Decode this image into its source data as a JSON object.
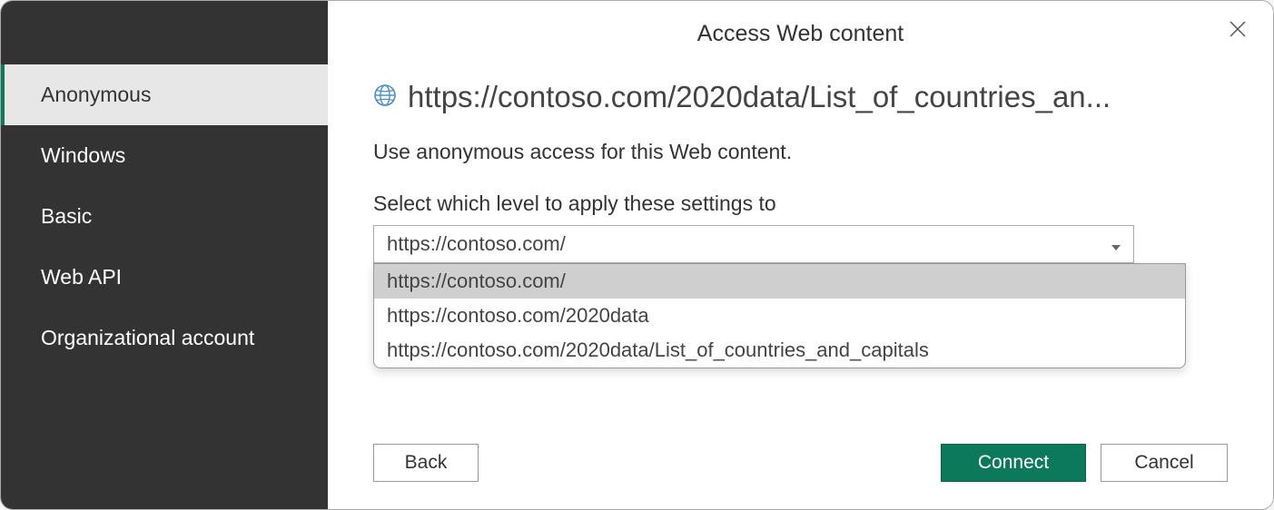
{
  "dialog": {
    "title": "Access Web content",
    "url": "https://contoso.com/2020data/List_of_countries_an...",
    "description": "Use anonymous access for this Web content.",
    "select_label": "Select which level to apply these settings to",
    "select_value": "https://contoso.com/"
  },
  "sidebar": {
    "items": [
      {
        "label": "Anonymous",
        "active": true
      },
      {
        "label": "Windows",
        "active": false
      },
      {
        "label": "Basic",
        "active": false
      },
      {
        "label": "Web API",
        "active": false
      },
      {
        "label": "Organizational account",
        "active": false
      }
    ]
  },
  "dropdown": {
    "options": [
      {
        "label": "https://contoso.com/",
        "highlight": true
      },
      {
        "label": "https://contoso.com/2020data",
        "highlight": false
      },
      {
        "label": "https://contoso.com/2020data/List_of_countries_and_capitals",
        "highlight": false
      }
    ]
  },
  "buttons": {
    "back": "Back",
    "connect": "Connect",
    "cancel": "Cancel"
  }
}
